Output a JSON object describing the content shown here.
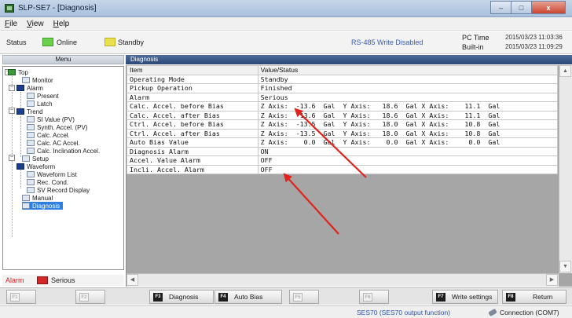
{
  "window": {
    "title": "SLP-SE7 - [Diagnosis]",
    "buttons": {
      "minimize": "–",
      "maximize": "□",
      "close": "x"
    }
  },
  "menu": [
    {
      "u": "F",
      "rest": "ile"
    },
    {
      "u": "V",
      "rest": "iew"
    },
    {
      "u": "H",
      "rest": "elp"
    }
  ],
  "status": {
    "label": "Status",
    "online": "Online",
    "standby": "Standby",
    "rs485": "RS-485 Write Disabled",
    "pc_time_label": "PC Time",
    "builtin_label": "Built-in",
    "pc_time": "2015/03/23 11:03:36",
    "builtin_time": "2015/03/23 11:09:29",
    "colors": {
      "online": "#6bd04a",
      "standby": "#e9e04b"
    }
  },
  "sidebar": {
    "header": "Menu",
    "tree": [
      {
        "label": "Top",
        "icon": "folder-green-icon",
        "level": 0
      },
      {
        "label": "Monitor",
        "icon": "page-icon",
        "level": 1
      },
      {
        "label": "Alarm",
        "icon": "folder-icon",
        "level": 1
      },
      {
        "label": "Present",
        "icon": "page-icon",
        "level": 2
      },
      {
        "label": "Latch",
        "icon": "page-icon",
        "level": 2
      },
      {
        "label": "Trend",
        "icon": "folder-icon",
        "level": 1
      },
      {
        "label": "SI Value (PV)",
        "icon": "page-icon",
        "level": 2
      },
      {
        "label": "Synth. Accel. (PV)",
        "icon": "page-icon",
        "level": 2
      },
      {
        "label": "Calc. Accel.",
        "icon": "page-icon",
        "level": 2
      },
      {
        "label": "Calc. AC Accel.",
        "icon": "page-icon",
        "level": 2
      },
      {
        "label": "Calc. Inclination Accel.",
        "icon": "page-icon",
        "level": 2
      },
      {
        "label": "Setup",
        "icon": "page-icon",
        "level": 1
      },
      {
        "label": "Waveform",
        "icon": "folder-icon",
        "level": 1
      },
      {
        "label": "Waveform List",
        "icon": "page-icon",
        "level": 2
      },
      {
        "label": "Rec. Cond.",
        "icon": "page-icon",
        "level": 2
      },
      {
        "label": "SV Record Display",
        "icon": "page-icon",
        "level": 2
      },
      {
        "label": "Manual",
        "icon": "page-icon",
        "level": 1
      },
      {
        "label": "Diagnosis",
        "icon": "page-icon",
        "level": 1,
        "selected": true
      }
    ]
  },
  "alarm": {
    "label": "Alarm",
    "value": "Serious",
    "color": "#d32626"
  },
  "main": {
    "header": "Diagnosis",
    "columns": [
      "Item",
      "Value/Status"
    ],
    "rows": [
      {
        "item": "Operating Mode",
        "value": "Standby"
      },
      {
        "item": "Pickup Operation",
        "value": "Finished"
      },
      {
        "item": "Alarm",
        "value": "Serious"
      },
      {
        "item": "Calc. Accel. before Bias",
        "value": "Z Axis:  -13.6  Gal  Y Axis:   18.6  Gal X Axis:    11.1  Gal"
      },
      {
        "item": "Calc. Accel. after Bias",
        "value": "Z Axis:  -13.6  Gal  Y Axis:   18.6  Gal X Axis:    11.1  Gal"
      },
      {
        "item": "Ctrl. Accel. before Bias",
        "value": "Z Axis:  -13.5  Gal  Y Axis:   18.0  Gal X Axis:    10.8  Gal"
      },
      {
        "item": "Ctrl. Accel. after Bias",
        "value": "Z Axis:  -13.5  Gal  Y Axis:   18.0  Gal X Axis:    10.8  Gal"
      },
      {
        "item": "Auto Bias Value",
        "value": "Z Axis:    0.0  Gal  Y Axis:    0.0  Gal X Axis:     0.0  Gal"
      },
      {
        "item": "Diagnosis Alarm",
        "value": "ON"
      },
      {
        "item": "Accel. Value Alarm",
        "value": "OFF"
      },
      {
        "item": "Incli. Accel. Alarm",
        "value": "OFF"
      }
    ]
  },
  "fkeys": [
    {
      "key": "F1",
      "label": "",
      "enabled": false
    },
    {
      "key": "F2",
      "label": "",
      "enabled": false
    },
    {
      "key": "F3",
      "label": "Diagnosis",
      "enabled": true
    },
    {
      "key": "F4",
      "label": "Auto Bias",
      "enabled": true
    },
    {
      "key": "F5",
      "label": "",
      "enabled": false
    },
    {
      "key": "F6",
      "label": "",
      "enabled": false
    },
    {
      "key": "F7",
      "label": "Write settings",
      "enabled": true
    },
    {
      "key": "F8",
      "label": "Return",
      "enabled": true
    }
  ],
  "footer": {
    "function": "SES70 (SES70 output function)",
    "connection": "Connection (COM7)"
  },
  "annotation_color": "#e0231b"
}
